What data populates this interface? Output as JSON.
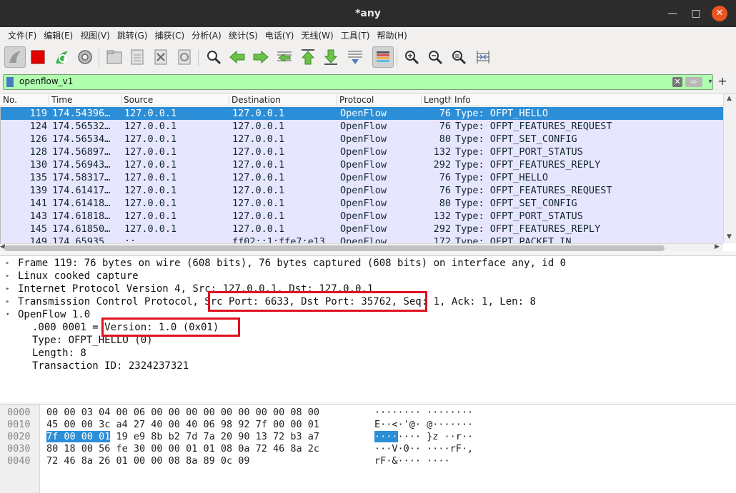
{
  "window": {
    "title": "*any",
    "minimize_glyph": "—",
    "maximize_glyph": "□",
    "close_glyph": "✕"
  },
  "menu": [
    "文件(F)",
    "编辑(E)",
    "视图(V)",
    "跳转(G)",
    "捕获(C)",
    "分析(A)",
    "统计(S)",
    "电话(Y)",
    "无线(W)",
    "工具(T)",
    "帮助(H)"
  ],
  "toolbar": {
    "icons": [
      "shark-fin-start-icon",
      "stop-square-icon",
      "restart-capture-icon",
      "capture-options-gear-icon",
      "open-folder-icon",
      "save-file-icon",
      "close-file-icon",
      "reload-icon",
      "search-magnifier-icon",
      "go-back-icon",
      "go-forward-icon",
      "go-to-packet-icon",
      "go-first-icon",
      "go-last-icon",
      "autoscroll-icon",
      "colorize-icon",
      "zoom-in-icon",
      "zoom-out-icon",
      "zoom-normal-icon",
      "resize-columns-icon"
    ]
  },
  "filter": {
    "value": "openflow_v1",
    "clear_glyph": "✕",
    "apply_glyph": "⇨",
    "dropdown_glyph": "▾",
    "add_glyph": "+"
  },
  "packet_list": {
    "columns": [
      "No.",
      "Time",
      "Source",
      "Destination",
      "Protocol",
      "Length",
      "Info"
    ],
    "rows": [
      {
        "no": "119",
        "time": "174.54396…",
        "src": "127.0.0.1",
        "dst": "127.0.0.1",
        "proto": "OpenFlow",
        "len": "76",
        "info": "Type: OFPT_HELLO",
        "selected": true
      },
      {
        "no": "124",
        "time": "174.56532…",
        "src": "127.0.0.1",
        "dst": "127.0.0.1",
        "proto": "OpenFlow",
        "len": "76",
        "info": "Type: OFPT_FEATURES_REQUEST",
        "selected": false
      },
      {
        "no": "126",
        "time": "174.56534…",
        "src": "127.0.0.1",
        "dst": "127.0.0.1",
        "proto": "OpenFlow",
        "len": "80",
        "info": "Type: OFPT_SET_CONFIG",
        "selected": false
      },
      {
        "no": "128",
        "time": "174.56897…",
        "src": "127.0.0.1",
        "dst": "127.0.0.1",
        "proto": "OpenFlow",
        "len": "132",
        "info": "Type: OFPT_PORT_STATUS",
        "selected": false
      },
      {
        "no": "130",
        "time": "174.56943…",
        "src": "127.0.0.1",
        "dst": "127.0.0.1",
        "proto": "OpenFlow",
        "len": "292",
        "info": "Type: OFPT_FEATURES_REPLY",
        "selected": false
      },
      {
        "no": "135",
        "time": "174.58317…",
        "src": "127.0.0.1",
        "dst": "127.0.0.1",
        "proto": "OpenFlow",
        "len": "76",
        "info": "Type: OFPT_HELLO",
        "selected": false
      },
      {
        "no": "139",
        "time": "174.61417…",
        "src": "127.0.0.1",
        "dst": "127.0.0.1",
        "proto": "OpenFlow",
        "len": "76",
        "info": "Type: OFPT_FEATURES_REQUEST",
        "selected": false
      },
      {
        "no": "141",
        "time": "174.61418…",
        "src": "127.0.0.1",
        "dst": "127.0.0.1",
        "proto": "OpenFlow",
        "len": "80",
        "info": "Type: OFPT_SET_CONFIG",
        "selected": false
      },
      {
        "no": "143",
        "time": "174.61818…",
        "src": "127.0.0.1",
        "dst": "127.0.0.1",
        "proto": "OpenFlow",
        "len": "132",
        "info": "Type: OFPT_PORT_STATUS",
        "selected": false
      },
      {
        "no": "145",
        "time": "174.61850…",
        "src": "127.0.0.1",
        "dst": "127.0.0.1",
        "proto": "OpenFlow",
        "len": "292",
        "info": "Type: OFPT_FEATURES_REPLY",
        "selected": false
      },
      {
        "no": "149",
        "time": "174.65935…",
        "src": "::",
        "dst": "ff02::1:ffe7:e13",
        "proto": "OpenFlow",
        "len": "172",
        "info": "Type: OFPT_PACKET_IN",
        "selected": false
      }
    ]
  },
  "details": {
    "rows": [
      {
        "arrow": "▸",
        "text": "Frame 119: 76 bytes on wire (608 bits), 76 bytes captured (608 bits) on interface any, id 0"
      },
      {
        "arrow": "▸",
        "text": "Linux cooked capture"
      },
      {
        "arrow": "▸",
        "text": "Internet Protocol Version 4, Src: 127.0.0.1, Dst: 127.0.0.1"
      },
      {
        "arrow": "▸",
        "text": "Transmission Control Protocol, Src Port: 6633, Dst Port: 35762, Seq: 1, Ack: 1, Len: 8"
      },
      {
        "arrow": "▾",
        "text": "OpenFlow 1.0"
      },
      {
        "arrow": "",
        "text": ".000 0001 = Version: 1.0 (0x01)"
      },
      {
        "arrow": "",
        "text": "Type: OFPT_HELLO (0)"
      },
      {
        "arrow": "",
        "text": "Length: 8"
      },
      {
        "arrow": "",
        "text": "Transaction ID: 2324237321"
      }
    ],
    "highlight_color": "#e0101f"
  },
  "bytes": {
    "rows": [
      {
        "offset": "0000",
        "hex": "00 00 03 04 00 06 00 00  00 00 00 00 00 00 08 00",
        "ascii": "········ ········"
      },
      {
        "offset": "0010",
        "hex": "45 00 00 3c a4 27 40 00  40 06 98 92 7f 00 00 01",
        "ascii": "E··<·'@· @·······"
      },
      {
        "offset": "0020",
        "hex_sel": "7f 00 00 01",
        "hex_rest": " 19 e9 8b b2  7d 7a 20 90 13 72 b3 a7",
        "ascii_sel": "····",
        "ascii_rest": "···· }z ··r··"
      },
      {
        "offset": "0030",
        "hex": "80 18 00 56 fe 30 00 00  01 01 08 0a 72 46 8a 2c",
        "ascii": "···V·0·· ····rF·,"
      },
      {
        "offset": "0040",
        "hex": "72 46 8a 26 01 00 00 08  8a 89 0c 09",
        "ascii": "rF·&···· ····"
      }
    ]
  },
  "colors": {
    "selection": "#2c8ed6",
    "row_bg": "#e7e6ff",
    "filter_valid": "#afffaf",
    "close_button": "#e95420"
  }
}
